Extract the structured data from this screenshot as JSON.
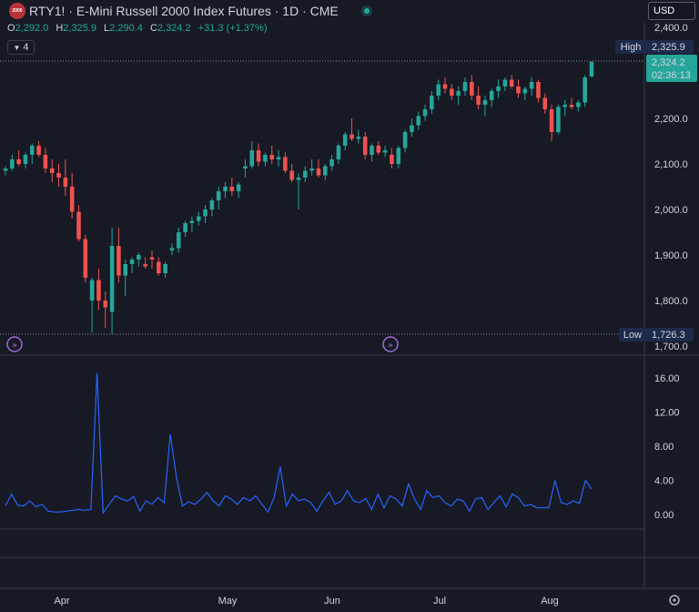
{
  "header": {
    "symbol_badge": "2000",
    "title": "RTY1! · E-Mini Russell 2000 Index Futures · 1D · CME",
    "currency": "USD",
    "collapse_label": "4"
  },
  "ohlc": {
    "open_key": "O",
    "open": "2,292.0",
    "high_key": "H",
    "high": "2,325.9",
    "low_key": "L",
    "low": "2,290.4",
    "close_key": "C",
    "close": "2,324.2",
    "change": "+31.3 (+1.37%)"
  },
  "price_labels": {
    "high_tag": "High",
    "high_value": "2,325.9",
    "low_tag": "Low",
    "low_value": "1,726.3",
    "last_price": "2,324.2",
    "countdown": "02:36:13"
  },
  "colors": {
    "up": "#26a69a",
    "down": "#ef5350",
    "indicator": "#2962ff",
    "background": "#171a24",
    "badge": "#1e2a4a"
  },
  "x_axis_labels": [
    "Apr",
    "May",
    "Jun",
    "Jul",
    "Aug"
  ],
  "chart_data": [
    {
      "type": "candlestick",
      "title": "",
      "y_ticks": [
        "2,400.0",
        "2,300.0",
        "2,200.0",
        "2,100.0",
        "2,000.0",
        "1,900.0",
        "1,800.0",
        "1,700.0"
      ],
      "ylim": [
        1700,
        2400
      ],
      "high_line": 2325.9,
      "low_line": 1726.3,
      "candles": [
        [
          2085,
          2095,
          2075,
          2090
        ],
        [
          2090,
          2120,
          2085,
          2110
        ],
        [
          2110,
          2130,
          2095,
          2100
        ],
        [
          2100,
          2125,
          2090,
          2120
        ],
        [
          2120,
          2145,
          2100,
          2140
        ],
        [
          2140,
          2150,
          2115,
          2120
        ],
        [
          2120,
          2135,
          2080,
          2090
        ],
        [
          2090,
          2110,
          2060,
          2080
        ],
        [
          2080,
          2100,
          2050,
          2070
        ],
        [
          2070,
          2110,
          2030,
          2050
        ],
        [
          2050,
          2080,
          1980,
          1995
        ],
        [
          1995,
          2010,
          1930,
          1935
        ],
        [
          1935,
          1945,
          1840,
          1850
        ],
        [
          1800,
          1850,
          1730,
          1845
        ],
        [
          1845,
          1870,
          1780,
          1800
        ],
        [
          1800,
          1820,
          1740,
          1785
        ],
        [
          1775,
          1960,
          1727,
          1920
        ],
        [
          1920,
          1960,
          1840,
          1855
        ],
        [
          1855,
          1890,
          1810,
          1880
        ],
        [
          1880,
          1895,
          1860,
          1890
        ],
        [
          1890,
          1905,
          1875,
          1900
        ],
        [
          1880,
          1895,
          1870,
          1875
        ],
        [
          1895,
          1910,
          1870,
          1890
        ],
        [
          1885,
          1895,
          1855,
          1860
        ],
        [
          1860,
          1885,
          1850,
          1880
        ],
        [
          1910,
          1925,
          1900,
          1915
        ],
        [
          1915,
          1960,
          1905,
          1950
        ],
        [
          1950,
          1975,
          1940,
          1970
        ],
        [
          1970,
          1985,
          1950,
          1975
        ],
        [
          1975,
          1995,
          1965,
          1985
        ],
        [
          1985,
          2010,
          1970,
          2000
        ],
        [
          2000,
          2025,
          1985,
          2020
        ],
        [
          2020,
          2050,
          2000,
          2040
        ],
        [
          2040,
          2060,
          2025,
          2050
        ],
        [
          2050,
          2070,
          2030,
          2040
        ],
        [
          2040,
          2060,
          2025,
          2055
        ],
        [
          2090,
          2110,
          2070,
          2095
        ],
        [
          2095,
          2150,
          2090,
          2130
        ],
        [
          2130,
          2145,
          2095,
          2105
        ],
        [
          2105,
          2125,
          2095,
          2120
        ],
        [
          2120,
          2140,
          2100,
          2110
        ],
        [
          2110,
          2130,
          2095,
          2115
        ],
        [
          2115,
          2125,
          2080,
          2085
        ],
        [
          2085,
          2100,
          2060,
          2065
        ],
        [
          2065,
          2080,
          2000,
          2070
        ],
        [
          2070,
          2095,
          2060,
          2085
        ],
        [
          2085,
          2110,
          2075,
          2090
        ],
        [
          2090,
          2110,
          2070,
          2075
        ],
        [
          2075,
          2100,
          2065,
          2095
        ],
        [
          2095,
          2120,
          2085,
          2110
        ],
        [
          2110,
          2145,
          2100,
          2140
        ],
        [
          2140,
          2170,
          2130,
          2165
        ],
        [
          2165,
          2200,
          2150,
          2155
        ],
        [
          2155,
          2175,
          2145,
          2160
        ],
        [
          2160,
          2170,
          2110,
          2120
        ],
        [
          2120,
          2145,
          2105,
          2140
        ],
        [
          2140,
          2150,
          2120,
          2125
        ],
        [
          2125,
          2140,
          2115,
          2130
        ],
        [
          2120,
          2135,
          2090,
          2100
        ],
        [
          2100,
          2140,
          2090,
          2135
        ],
        [
          2135,
          2175,
          2125,
          2170
        ],
        [
          2170,
          2200,
          2160,
          2185
        ],
        [
          2185,
          2215,
          2175,
          2205
        ],
        [
          2205,
          2230,
          2195,
          2220
        ],
        [
          2220,
          2260,
          2210,
          2250
        ],
        [
          2250,
          2285,
          2240,
          2275
        ],
        [
          2275,
          2290,
          2255,
          2265
        ],
        [
          2265,
          2275,
          2240,
          2250
        ],
        [
          2250,
          2270,
          2230,
          2260
        ],
        [
          2260,
          2290,
          2250,
          2280
        ],
        [
          2280,
          2295,
          2240,
          2250
        ],
        [
          2250,
          2270,
          2220,
          2230
        ],
        [
          2230,
          2250,
          2205,
          2240
        ],
        [
          2240,
          2265,
          2225,
          2260
        ],
        [
          2260,
          2285,
          2245,
          2270
        ],
        [
          2270,
          2290,
          2260,
          2285
        ],
        [
          2285,
          2295,
          2265,
          2270
        ],
        [
          2270,
          2285,
          2245,
          2255
        ],
        [
          2255,
          2270,
          2240,
          2265
        ],
        [
          2265,
          2290,
          2250,
          2280
        ],
        [
          2280,
          2285,
          2235,
          2245
        ],
        [
          2245,
          2255,
          2210,
          2220
        ],
        [
          2220,
          2230,
          2150,
          2170
        ],
        [
          2170,
          2230,
          2165,
          2225
        ],
        [
          2225,
          2240,
          2205,
          2230
        ],
        [
          2230,
          2245,
          2220,
          2225
        ],
        [
          2225,
          2240,
          2215,
          2235
        ],
        [
          2235,
          2295,
          2225,
          2290
        ],
        [
          2292,
          2326,
          2290,
          2324
        ]
      ]
    },
    {
      "type": "line",
      "title": "",
      "y_ticks": [
        "16.00",
        "12.00",
        "8.00",
        "4.00",
        "0.00"
      ],
      "ylim": [
        -1.5,
        17.5
      ],
      "series": [
        {
          "values": [
            1.0,
            2.4,
            1.1,
            1.0,
            1.6,
            0.9,
            1.2,
            0.4,
            0.3,
            0.3,
            0.4,
            0.5,
            0.6,
            0.5,
            0.6,
            16.6,
            0.2,
            1.2,
            2.2,
            1.8,
            1.6,
            2.1,
            0.4,
            1.6,
            1.2,
            2.0,
            1.4,
            9.4,
            4.4,
            1.0,
            1.5,
            1.2,
            1.8,
            2.6,
            1.6,
            1.0,
            2.2,
            1.8,
            1.2,
            2.0,
            1.6,
            2.2,
            1.2,
            0.3,
            2.0,
            5.6,
            1.0,
            2.4,
            1.6,
            1.8,
            1.4,
            0.4,
            1.6,
            2.6,
            1.2,
            1.6,
            2.8,
            1.6,
            1.4,
            1.9,
            0.6,
            2.4,
            0.8,
            2.2,
            1.8,
            1.0,
            3.6,
            1.8,
            0.6,
            2.8,
            2.0,
            2.2,
            1.4,
            1.0,
            1.8,
            1.6,
            0.4,
            1.8,
            2.0,
            0.6,
            1.4,
            2.2,
            0.9,
            2.4,
            2.0,
            1.0,
            1.2,
            0.8,
            0.8,
            0.8,
            4.0,
            1.4,
            1.2,
            1.6,
            1.3,
            4.0,
            3.0
          ]
        }
      ]
    }
  ]
}
